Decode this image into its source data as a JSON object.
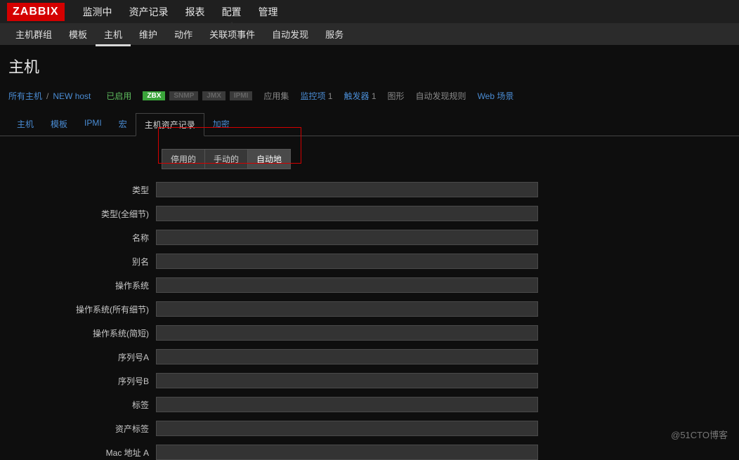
{
  "logo": "ZABBIX",
  "topnav": {
    "items": [
      {
        "label": "监测中"
      },
      {
        "label": "资产记录"
      },
      {
        "label": "报表"
      },
      {
        "label": "配置"
      },
      {
        "label": "管理"
      }
    ],
    "active_index": 3
  },
  "subnav": {
    "items": [
      {
        "label": "主机群组"
      },
      {
        "label": "模板"
      },
      {
        "label": "主机"
      },
      {
        "label": "维护"
      },
      {
        "label": "动作"
      },
      {
        "label": "关联项事件"
      },
      {
        "label": "自动发现"
      },
      {
        "label": "服务"
      }
    ],
    "active_index": 2
  },
  "page_title": "主机",
  "breadcrumb": {
    "all_hosts": "所有主机",
    "host_name": "NEW host",
    "status": "已启用",
    "badges": {
      "zbx": "ZBX",
      "snmp": "SNMP",
      "jmx": "JMX",
      "ipmi": "IPMI"
    },
    "links": [
      {
        "label": "应用集",
        "grey": true
      },
      {
        "label": "监控项",
        "grey": false,
        "count": "1"
      },
      {
        "label": "触发器",
        "grey": false,
        "count": "1"
      },
      {
        "label": "图形",
        "grey": true
      },
      {
        "label": "自动发现规则",
        "grey": true
      },
      {
        "label": "Web 场景",
        "grey": false
      }
    ]
  },
  "inner_tabs": {
    "items": [
      {
        "label": "主机"
      },
      {
        "label": "模板"
      },
      {
        "label": "IPMI"
      },
      {
        "label": "宏"
      },
      {
        "label": "主机资产记录"
      },
      {
        "label": "加密"
      }
    ],
    "active_index": 4
  },
  "toggle": {
    "options": [
      "停用的",
      "手动的",
      "自动地"
    ],
    "active_index": 2
  },
  "form_fields": [
    {
      "label": "类型",
      "value": ""
    },
    {
      "label": "类型(全细节)",
      "value": ""
    },
    {
      "label": "名称",
      "value": ""
    },
    {
      "label": "别名",
      "value": ""
    },
    {
      "label": "操作系统",
      "value": ""
    },
    {
      "label": "操作系统(所有细节)",
      "value": ""
    },
    {
      "label": "操作系统(简短)",
      "value": ""
    },
    {
      "label": "序列号A",
      "value": ""
    },
    {
      "label": "序列号B",
      "value": ""
    },
    {
      "label": "标签",
      "value": ""
    },
    {
      "label": "资产标签",
      "value": ""
    },
    {
      "label": "Mac 地址 A",
      "value": ""
    }
  ],
  "watermark": "@51CTO博客"
}
